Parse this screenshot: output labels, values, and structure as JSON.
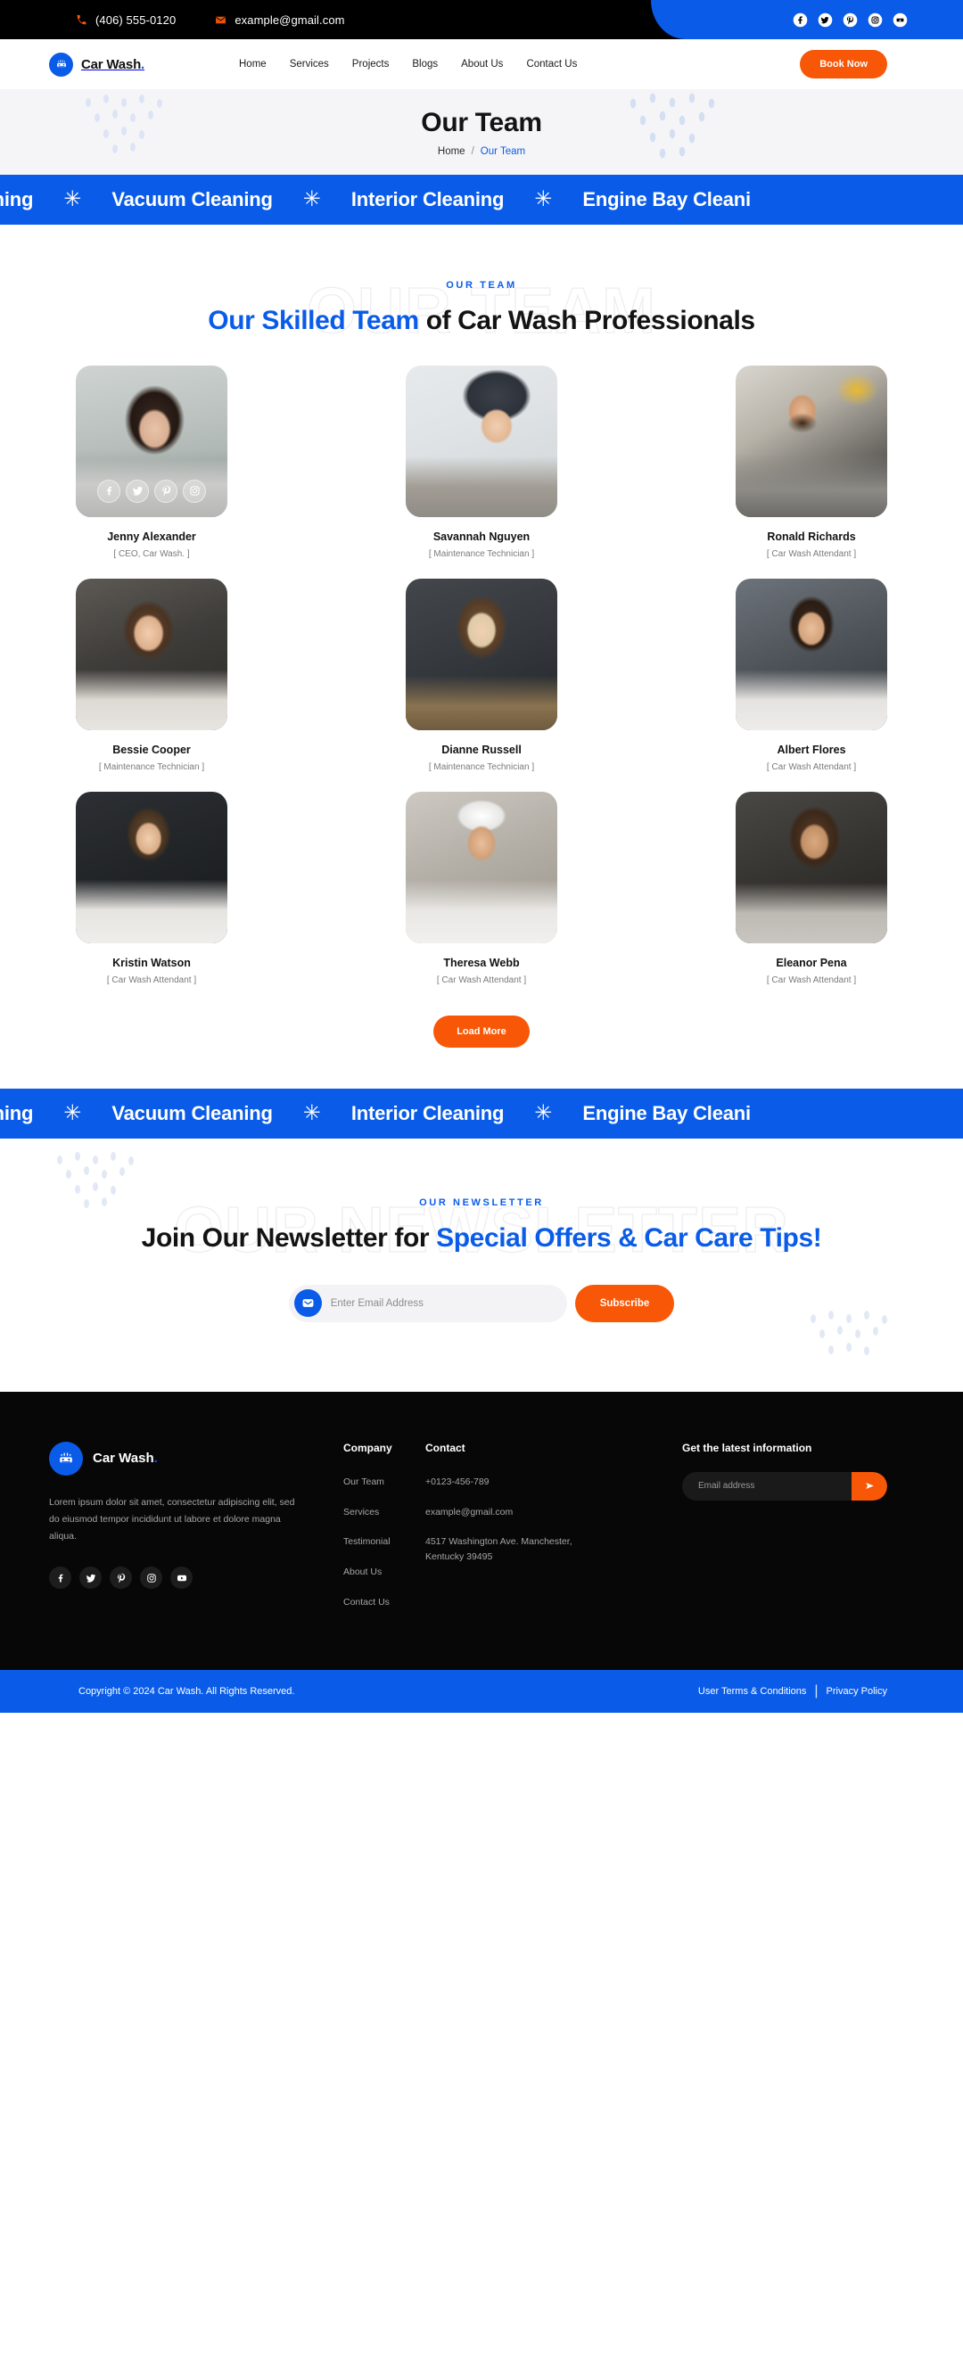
{
  "topbar": {
    "phone": "(406) 555-0120",
    "email": "example@gmail.com",
    "socials": [
      "facebook-icon",
      "twitter-icon",
      "pinterest-icon",
      "instagram-icon",
      "youtube-icon"
    ]
  },
  "header": {
    "brand": "Car Wash",
    "brand_dot": ".",
    "nav": [
      "Home",
      "Services",
      "Projects",
      "Blogs",
      "About Us",
      "Contact Us"
    ],
    "cta": "Book Now"
  },
  "banner": {
    "title": "Our Team",
    "crumb_home": "Home",
    "crumb_sep": "/",
    "crumb_current": "Our Team"
  },
  "marquee": {
    "items": [
      "terior Cleaning",
      "Vacuum Cleaning",
      "Interior Cleaning",
      "Engine Bay Cleani"
    ],
    "separator": "✳"
  },
  "team": {
    "ghost": "OUR TEAM",
    "eyebrow": "OUR TEAM",
    "title_blue": "Our Skilled Team",
    "title_rest": " of Car Wash Professionals",
    "members": [
      {
        "name": "Jenny Alexander",
        "role": "[ CEO, Car Wash. ]",
        "has_social": true
      },
      {
        "name": "Savannah Nguyen",
        "role": "[ Maintenance Technician ]",
        "has_social": false
      },
      {
        "name": "Ronald Richards",
        "role": "[ Car Wash Attendant ]",
        "has_social": false
      },
      {
        "name": "Bessie Cooper",
        "role": "[ Maintenance Technician ]",
        "has_social": false
      },
      {
        "name": "Dianne Russell",
        "role": "[ Maintenance Technician ]",
        "has_social": false
      },
      {
        "name": "Albert Flores",
        "role": "[ Car Wash Attendant ]",
        "has_social": false
      },
      {
        "name": "Kristin Watson",
        "role": "[ Car Wash Attendant ]",
        "has_social": false
      },
      {
        "name": "Theresa Webb",
        "role": "[ Car Wash Attendant ]",
        "has_social": false
      },
      {
        "name": "Eleanor Pena",
        "role": "[ Car Wash Attendant ]",
        "has_social": false
      }
    ],
    "card_socials": [
      "facebook-icon",
      "twitter-icon",
      "pinterest-icon",
      "instagram-icon"
    ],
    "load_more": "Load More"
  },
  "newsletter": {
    "ghost": "OUR NEWSLETTER",
    "eyebrow": "OUR NEWSLETTER",
    "title_dark": "Join Our Newsletter for ",
    "title_blue": "Special Offers & Car Care Tips!",
    "placeholder": "Enter Email Address",
    "value": "",
    "button": "Subscribe"
  },
  "footer": {
    "brand": "Car Wash",
    "brand_dot": ".",
    "description": "Lorem ipsum dolor sit amet, consectetur adipiscing elit, sed do eiusmod tempor incididunt ut labore et dolore magna aliqua.",
    "socials": [
      "facebook-icon",
      "twitter-icon",
      "pinterest-icon",
      "instagram-icon",
      "youtube-icon"
    ],
    "company": {
      "heading": "Company",
      "links": [
        "Our Team",
        "Services",
        "Testimonial",
        "About Us",
        "Contact Us"
      ]
    },
    "contact": {
      "heading": "Contact",
      "phone": "+0123-456-789",
      "email": "example@gmail.com",
      "address": "4517 Washington Ave. Manchester, Kentucky 39495"
    },
    "news": {
      "heading": "Get the latest information",
      "placeholder": "Email address",
      "value": ""
    }
  },
  "copyright": {
    "text": "Copyright © 2024 Car Wash. All Rights Reserved.",
    "terms": "User Terms & Conditions",
    "bar": "|",
    "privacy": "Privacy Policy"
  },
  "colors": {
    "brand_blue": "#0a5ce8",
    "accent_orange": "#f75706",
    "dark": "#070707",
    "banner_bg": "#f5f5f7"
  }
}
